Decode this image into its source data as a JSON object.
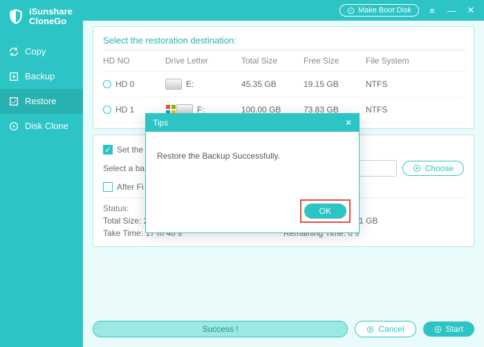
{
  "brand": {
    "line1": "iSunshare",
    "line2": "CloneGo"
  },
  "titlebar": {
    "boot_btn": "Make Boot Disk"
  },
  "sidebar": {
    "items": [
      {
        "label": "Copy"
      },
      {
        "label": "Backup"
      },
      {
        "label": "Restore"
      },
      {
        "label": "Disk Clone"
      }
    ]
  },
  "dest": {
    "title": "Select the restoration destination:",
    "cols": {
      "hd": "HD NO",
      "dl": "Drive Letter",
      "ts": "Total Size",
      "fs": "Free Size",
      "fy": "File System"
    },
    "rows": [
      {
        "hd": "HD 0",
        "dl": "E:",
        "ts": "45.35 GB",
        "fs": "19.15 GB",
        "fy": "NTFS"
      },
      {
        "hd": "HD 1",
        "dl": "F:",
        "ts": "100.00 GB",
        "fs": "73.83 GB",
        "fy": "NTFS"
      }
    ]
  },
  "options": {
    "set_label": "Set the",
    "select_label": "Select a ba",
    "after_label": "After Fi",
    "choose_btn": "Choose"
  },
  "status": {
    "title": "Status:",
    "total": "Total Size: 26.11 GB",
    "restored": "Have Restored: 26.11 GB",
    "take": "Take Time: 17 m 40 s",
    "remain": "Remaining Time: 0 s"
  },
  "bottom": {
    "progress_label": "Success !",
    "cancel": "Cancel",
    "start": "Start"
  },
  "modal": {
    "title": "Tips",
    "message": "Restore the Backup Successfully.",
    "ok": "OK"
  }
}
